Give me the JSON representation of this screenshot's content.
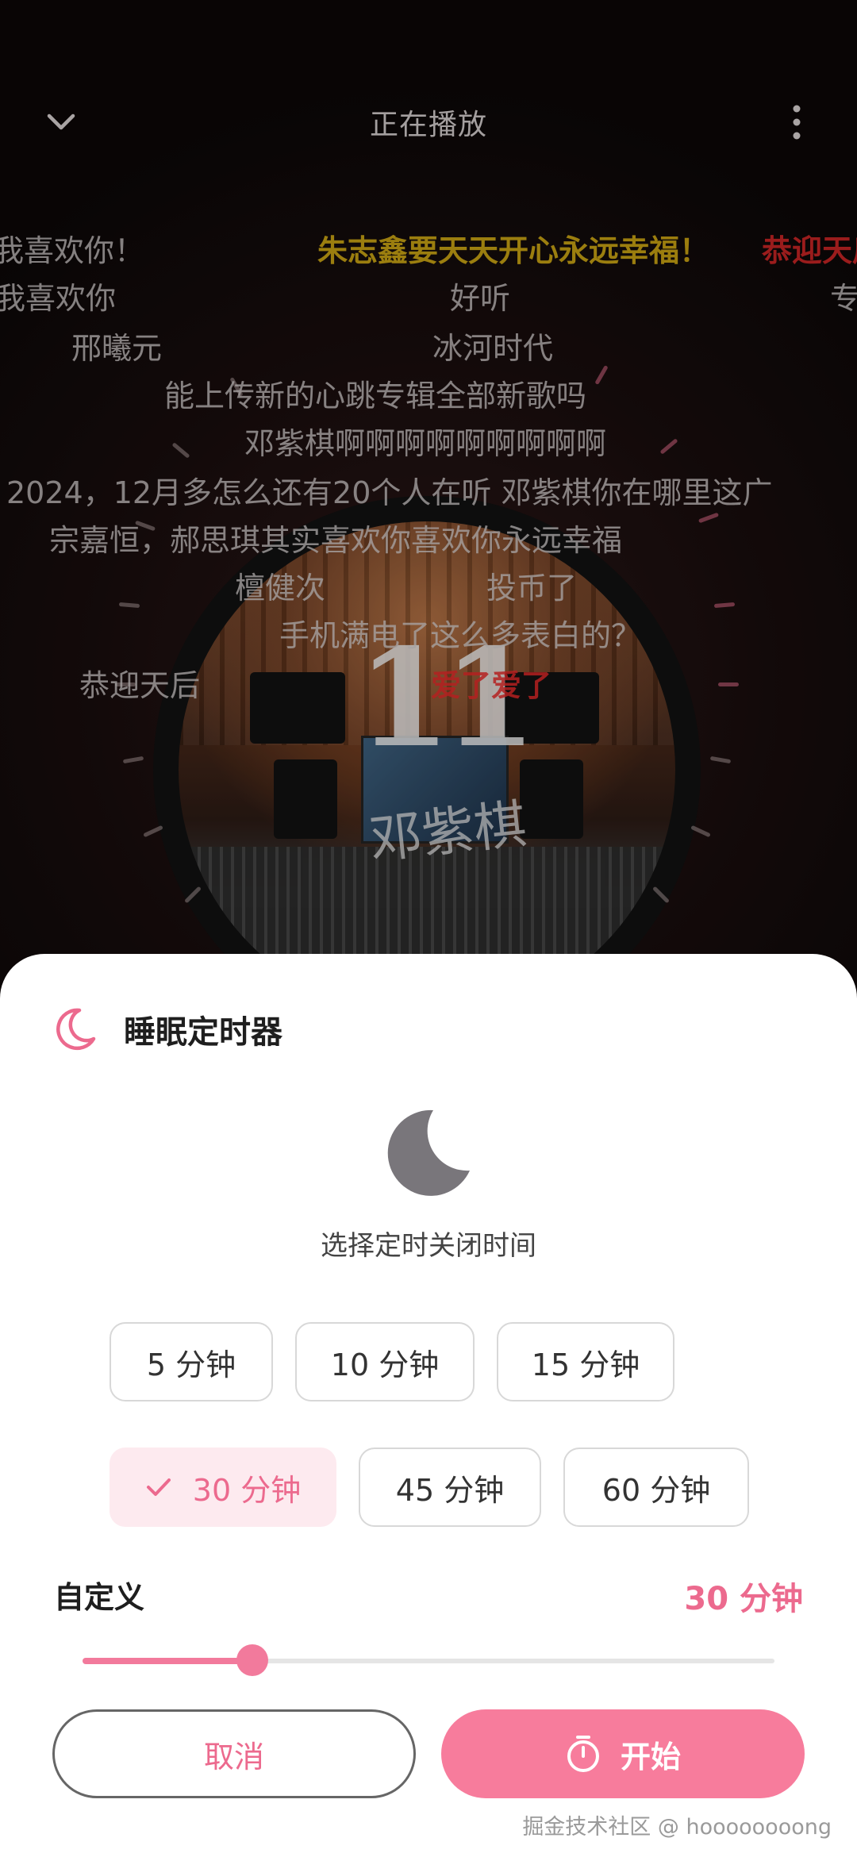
{
  "player": {
    "title": "正在播放",
    "album": {
      "number": "11",
      "artist": "邓紫棋"
    },
    "danmaku": [
      "我喜欢你！",
      "朱志鑫要天天开心永远幸福！",
      "恭迎天后",
      "我喜欢你",
      "好听",
      "专",
      "邢曦元",
      "冰河时代",
      "能上传新的心跳专辑全部新歌吗",
      "邓紫棋啊啊啊啊啊啊啊啊啊",
      "2024，12月多怎么还有20个人在听 邓紫棋你在哪里这广",
      "宗嘉恒，郝思琪其实喜欢你喜欢你永远幸福",
      "檀健次",
      "投币了",
      "手机满电了这么多表白的？",
      "恭迎天后",
      "爱了爱了"
    ]
  },
  "sleep_timer": {
    "title": "睡眠定时器",
    "subtitle": "选择定时关闭时间",
    "options": [
      {
        "label": "5 分钟",
        "selected": false
      },
      {
        "label": "10 分钟",
        "selected": false
      },
      {
        "label": "15 分钟",
        "selected": false
      },
      {
        "label": "30 分钟",
        "selected": true
      },
      {
        "label": "45 分钟",
        "selected": false
      },
      {
        "label": "60 分钟",
        "selected": false
      }
    ],
    "custom_label": "自定义",
    "custom_value": "30 分钟",
    "slider_fraction": 0.245,
    "cancel_label": "取消",
    "start_label": "开始"
  },
  "watermark": "掘金技术社区 @ hoooooooong",
  "colors": {
    "accent": "#f77c9c",
    "accent_text": "#ec6a8e",
    "selected_bg": "#fdeaef"
  }
}
